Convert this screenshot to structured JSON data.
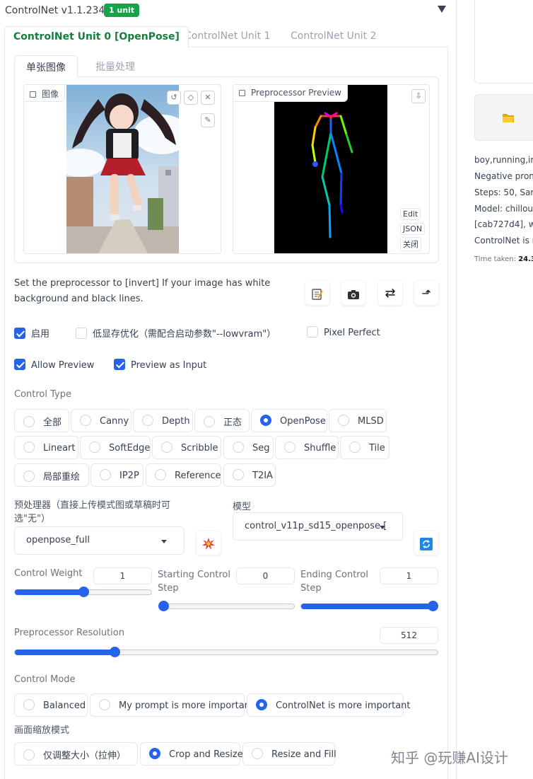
{
  "header": {
    "title": "ControlNet v1.1.234",
    "badge": "1 unit"
  },
  "unit_tabs": [
    "ControlNet Unit 0 [OpenPose]",
    "ControlNet Unit 1",
    "ControlNet Unit 2"
  ],
  "image_tabs": [
    "单张图像",
    "批量处理"
  ],
  "image_card": {
    "label": "图像"
  },
  "preview_card": {
    "label": "Preprocessor Preview",
    "buttons": [
      "Edit",
      "JSON",
      "关闭"
    ]
  },
  "hint": "Set the preprocessor to [invert] If your image has white background and black lines.",
  "checks_row1": [
    {
      "label": "启用",
      "checked": true
    },
    {
      "label": "低显存优化（需配合启动参数\"--lowvram\"）",
      "checked": false
    },
    {
      "label": "Pixel Perfect",
      "checked": false
    }
  ],
  "checks_row2": [
    {
      "label": "Allow Preview",
      "checked": true
    },
    {
      "label": "Preview as Input",
      "checked": true
    }
  ],
  "control_type": {
    "label": "Control Type",
    "options": [
      "全部",
      "Canny",
      "Depth",
      "正态",
      "OpenPose",
      "MLSD",
      "Lineart",
      "SoftEdge",
      "Scribble",
      "Seg",
      "Shuffle",
      "Tile",
      "局部重绘",
      "IP2P",
      "Reference",
      "T2IA"
    ],
    "selected": "OpenPose"
  },
  "preprocessor": {
    "label": "预处理器（直接上传模式图或草稿时可选\"无\"）",
    "value": "openpose_full"
  },
  "model": {
    "label": "模型",
    "value": "control_v11p_sd15_openpose ["
  },
  "control_weight": {
    "label": "Control Weight",
    "value": "1",
    "fraction": 0.5
  },
  "starting_step": {
    "label": "Starting Control Step",
    "value": "0",
    "fraction": 0.0
  },
  "ending_step": {
    "label": "Ending Control Step",
    "value": "1",
    "fraction": 1.0
  },
  "resolution": {
    "label": "Preprocessor Resolution",
    "value": "512",
    "fraction": 0.235
  },
  "control_mode": {
    "label": "Control Mode",
    "options": [
      "Balanced",
      "My prompt is more important",
      "ControlNet is more important"
    ],
    "selected": "ControlNet is more important"
  },
  "resize_mode": {
    "label": "画面缩放模式",
    "options": [
      "仅调整大小（拉伸）",
      "Crop and Resize",
      "Resize and Fill"
    ],
    "selected": "Crop and Resize"
  },
  "right_panel": {
    "info_lines": [
      "boy,running,ir",
      "Negative prom",
      "Steps: 50, Sam",
      "Model: chillou",
      "[cab727d4], wi",
      "ControlNet is n"
    ],
    "time_label": "Time taken:",
    "time_value": "24.3"
  },
  "watermark": "知乎 @玩赚AI设计",
  "colors": {
    "accent": "#2563eb",
    "badge": "#16a34a",
    "active_tab": "#15803d"
  }
}
